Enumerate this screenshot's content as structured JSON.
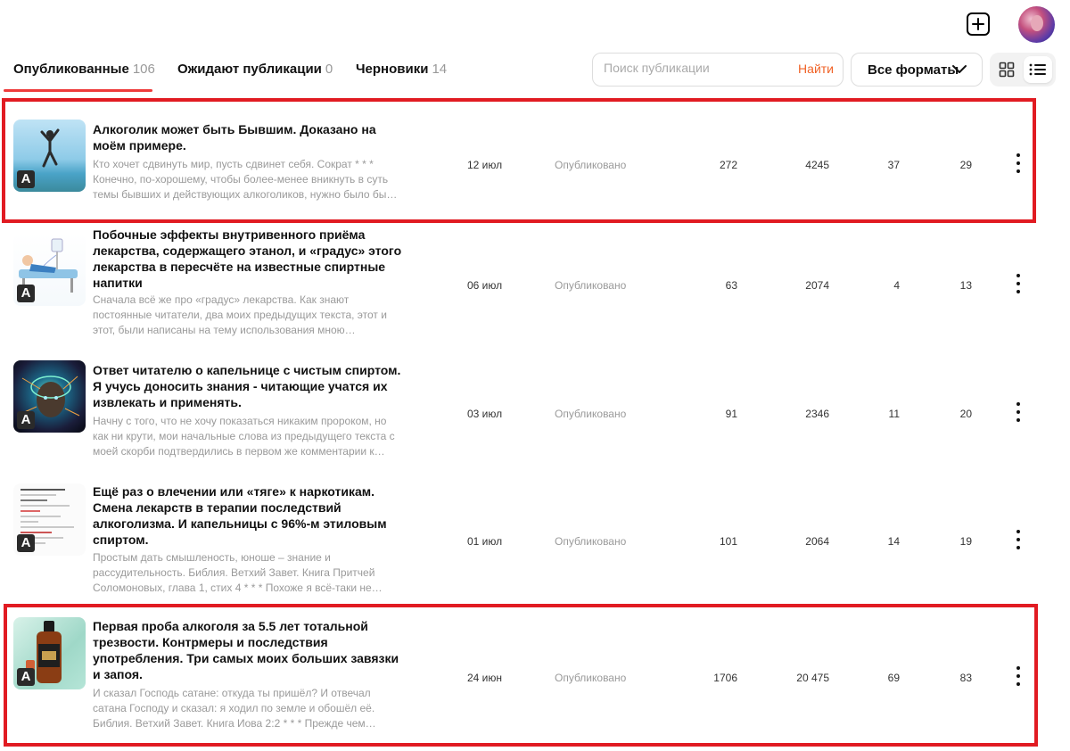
{
  "header": {
    "add_icon": "plus-square-icon",
    "avatar_icon": "user-avatar"
  },
  "tabs": [
    {
      "label": "Опубликованные",
      "count": "106",
      "active": true
    },
    {
      "label": "Ожидают публикации",
      "count": "0",
      "active": false
    },
    {
      "label": "Черновики",
      "count": "14",
      "active": false
    }
  ],
  "search": {
    "placeholder": "Поиск публикации",
    "value": "",
    "button": "Найти"
  },
  "format_filter": {
    "selected": "Все форматы"
  },
  "view_toggle": {
    "grid_icon": "grid-view-icon",
    "list_icon": "list-view-icon",
    "active": "list"
  },
  "colors": {
    "accent": "#f06226",
    "highlight": "#e11b22",
    "tab_underline": "#ee3b3b"
  },
  "publications": [
    {
      "title": "Алкоголик может быть Бывшим. Доказано на моём примере.",
      "description": "Кто хочет сдвинуть мир, пусть сдвинет себя. Сократ * * * Конечно, по-хорошему, чтобы более-менее вникнуть в суть темы бывших и действующих алкоголиков, нужно было бы…",
      "badge": "A",
      "date": "12 июл",
      "status": "Опубликовано",
      "views": "272",
      "reads": "4245",
      "likes": "37",
      "comments": "29",
      "highlighted": true
    },
    {
      "title": "Побочные эффекты внутривенного приёма лекарства, содержащего этанол, и «градус» этого лекарства в пересчёте на известные спиртные напитки",
      "description": "Сначала всё же про «градус» лекарства. Как знают постоянные читатели, два моих предыдущих текста, этот и этот, были написаны на тему использования мною…",
      "badge": "A",
      "date": "06 июл",
      "status": "Опубликовано",
      "views": "63",
      "reads": "2074",
      "likes": "4",
      "comments": "13",
      "highlighted": false
    },
    {
      "title": "Ответ читателю о капельнице с чистым спиртом. Я учусь доносить знания - читающие учатся их извлекать и применять.",
      "description": "Начну с того, что не хочу показаться никаким пророком, но как ни крути, мои начальные слова из предыдущего текста с моей скорби подтвердились в первом же комментарии к…",
      "badge": "A",
      "date": "03 июл",
      "status": "Опубликовано",
      "views": "91",
      "reads": "2346",
      "likes": "11",
      "comments": "20",
      "highlighted": false
    },
    {
      "title": "Ещё раз о влечении или «тяге» к наркотикам. Смена лекарств в терапии последствий алкоголизма. И капельницы с 96%-м этиловым спиртом.",
      "description": "Простым дать смышленость, юноше – знание и рассудительность. Библия. Ветхий Завет. Книга Притчей Соломоновых, глава 1, стих 4 * * * Похоже я всё-таки не…",
      "badge": "A",
      "date": "01 июл",
      "status": "Опубликовано",
      "views": "101",
      "reads": "2064",
      "likes": "14",
      "comments": "19",
      "highlighted": false
    },
    {
      "title": "Первая проба алкоголя за 5.5 лет тотальной трезвости. Контрмеры и последствия употребления. Три самых моих больших завязки и запоя.",
      "description": "И сказал Господь сатане: откуда ты пришёл? И отвечал сатана Господу и сказал: я ходил по земле и обошёл её. Библия. Ветхий Завет. Книга Иова 2:2 * * * Прежде чем…",
      "badge": "A",
      "date": "24 июн",
      "status": "Опубликовано",
      "views": "1706",
      "reads": "20 475",
      "likes": "69",
      "comments": "83",
      "highlighted": true
    }
  ]
}
